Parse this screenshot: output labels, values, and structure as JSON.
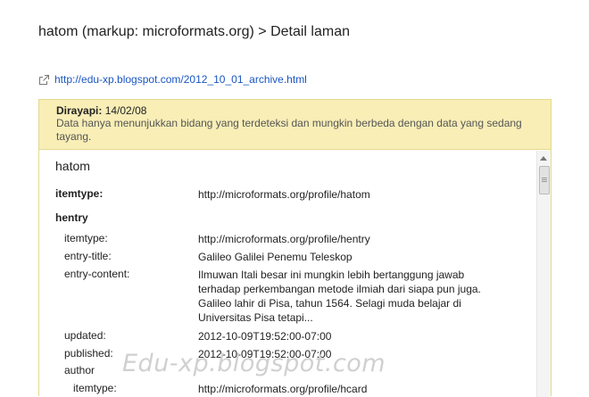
{
  "page": {
    "title": "hatom (markup: microformats.org) > Detail laman",
    "url": "http://edu-xp.blogspot.com/2012_10_01_archive.html",
    "url_icon": "external-link-icon"
  },
  "notice": {
    "crawled_label": "Dirayapi:",
    "crawled_date": "14/02/08",
    "message": "Data hanya menunjukkan bidang yang terdeteksi dan mungkin berbeda dengan data yang sedang tayang."
  },
  "details": {
    "type_name": "hatom",
    "itemtype_label": "itemtype:",
    "itemtype_value": "http://microformats.org/profile/hatom",
    "hentry_label": "hentry",
    "hentry": {
      "itemtype_label": "itemtype:",
      "itemtype_value": "http://microformats.org/profile/hentry",
      "entry_title_label": "entry-title:",
      "entry_title_value": "Galileo Galilei Penemu Teleskop",
      "entry_content_label": "entry-content:",
      "entry_content_value": "Ilmuwan Itali besar ini mungkin lebih bertanggung jawab terhadap perkembangan metode ilmiah dari siapa pun juga. Galileo lahir di Pisa, tahun 1564. Selagi muda belajar di Universitas Pisa tetapi...",
      "updated_label": "updated:",
      "updated_value": "2012-10-09T19:52:00-07:00",
      "published_label": "published:",
      "published_value": "2012-10-09T19:52:00-07:00",
      "author_label": "author",
      "author_itemtype_label": "itemtype:",
      "author_itemtype_value": "http://microformats.org/profile/hcard"
    }
  },
  "watermark": "Edu-xp.blogspot.com"
}
